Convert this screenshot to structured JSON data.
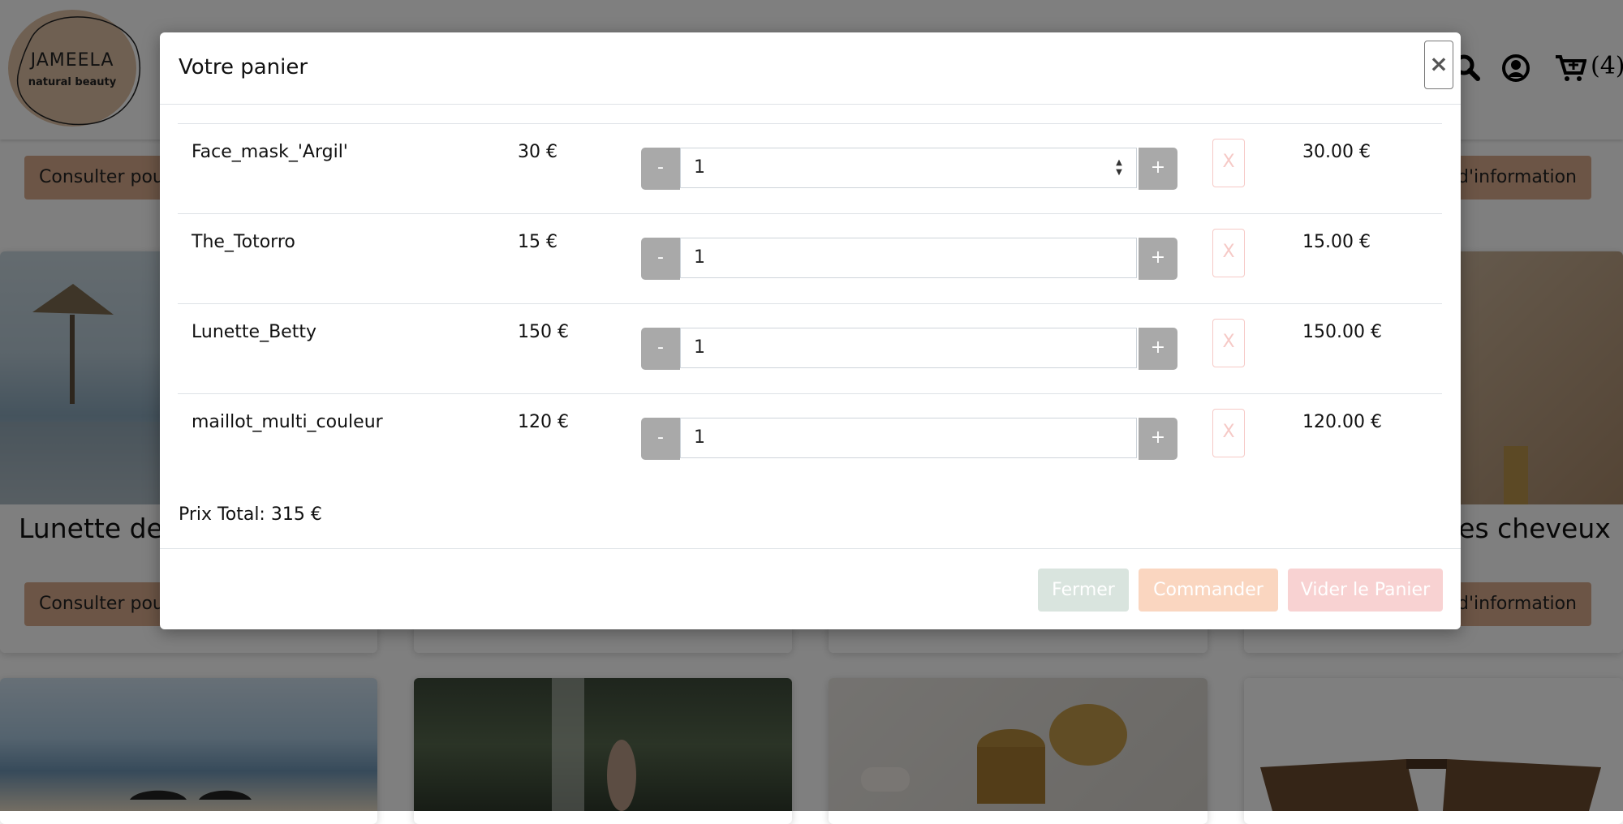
{
  "navbar": {
    "logo_name": "JAMEELA",
    "logo_tagline": "natural beauty",
    "cart_count": "(4)"
  },
  "background": {
    "info_button_left": "Consulter pou",
    "info_button_right": "d'information",
    "product_title_left": "Lunette de",
    "product_title_right": "les cheveux"
  },
  "modal": {
    "title": "Votre panier",
    "close_label": "×",
    "remove_label": "X",
    "minus_label": "-",
    "plus_label": "+",
    "items": [
      {
        "name": "Face_mask_'Argil'",
        "price": "30 €",
        "quantity": "1",
        "subtotal": "30.00 €"
      },
      {
        "name": "The_Totorro",
        "price": "15 €",
        "quantity": "1",
        "subtotal": "15.00 €"
      },
      {
        "name": "Lunette_Betty",
        "price": "150 €",
        "quantity": "1",
        "subtotal": "150.00 €"
      },
      {
        "name": "maillot_multi_couleur",
        "price": "120 €",
        "quantity": "1",
        "subtotal": "120.00 €"
      }
    ],
    "total": "Prix Total: 315 €",
    "footer": {
      "close_button": "Fermer",
      "order_button": "Commander",
      "empty_button": "Vider le Panier"
    }
  },
  "icons": {
    "search": "search-icon",
    "account": "user-circle-icon",
    "cart": "cart-plus-icon"
  },
  "colors": {
    "overlay": "#000000",
    "accent_beige": "#d9ab8c",
    "qty_button": "#a9a9a9",
    "close_button": "#d9e4de",
    "order_button": "#fad6c0",
    "empty_button": "#f8d2d2",
    "remove_border": "#f6c9c6"
  }
}
